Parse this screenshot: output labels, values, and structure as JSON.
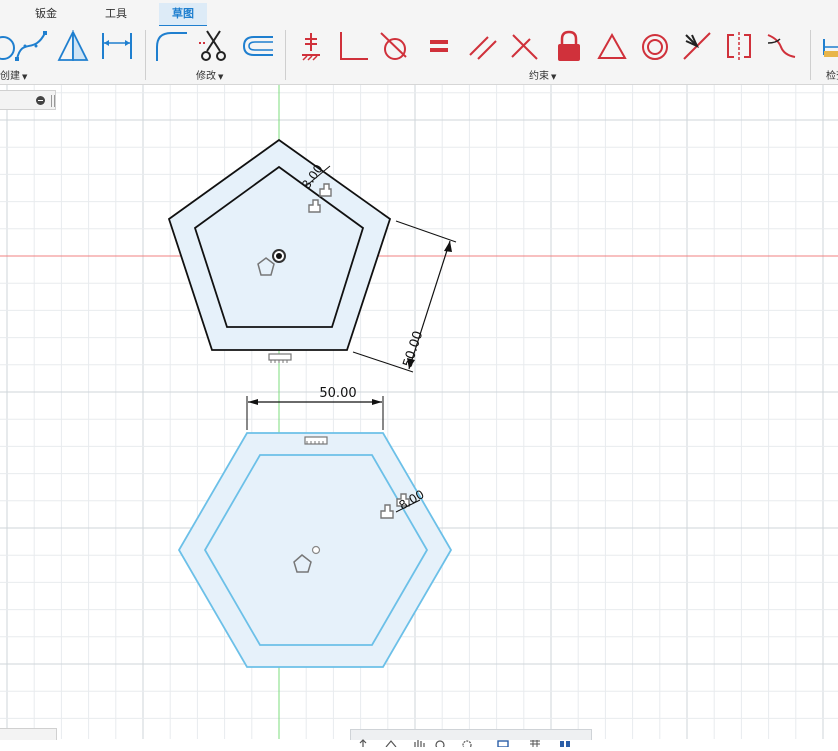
{
  "tabs": [
    {
      "label": "钣金"
    },
    {
      "label": "工具"
    },
    {
      "label": "草图"
    }
  ],
  "groups": {
    "create": "创建",
    "modify": "修改",
    "constraints": "约束",
    "inspect": "检查"
  },
  "tools": {
    "create": [
      "circle-icon",
      "spline-icon",
      "mirror-icon",
      "sketch-dimension-icon"
    ],
    "modify": [
      "fillet-icon",
      "trim-icon",
      "offset-icon"
    ],
    "constraints": [
      "fix-icon",
      "perpendicular-icon",
      "tangent-icon",
      "equal-icon",
      "parallel-icon",
      "intersect-icon",
      "lock-icon",
      "triangle-icon",
      "concentric-icon",
      "midpoint-icon",
      "symmetry-icon",
      "curvature-icon"
    ],
    "inspect": [
      "measure-icon"
    ]
  },
  "sketch": {
    "pentagon_side_dimension": "50.00",
    "pentagon_offset_dimension": "8.00",
    "hexagon_width_dimension": "50.00",
    "hexagon_offset_dimension": "8.00"
  },
  "colors": {
    "accent": "#1f7fcf",
    "constraint_red": "#d0313b",
    "profile_fill": "#e6f1fa",
    "selected_outline": "#6cc0e8",
    "x_axis": "#f08080",
    "y_axis": "#7ddc7d"
  }
}
